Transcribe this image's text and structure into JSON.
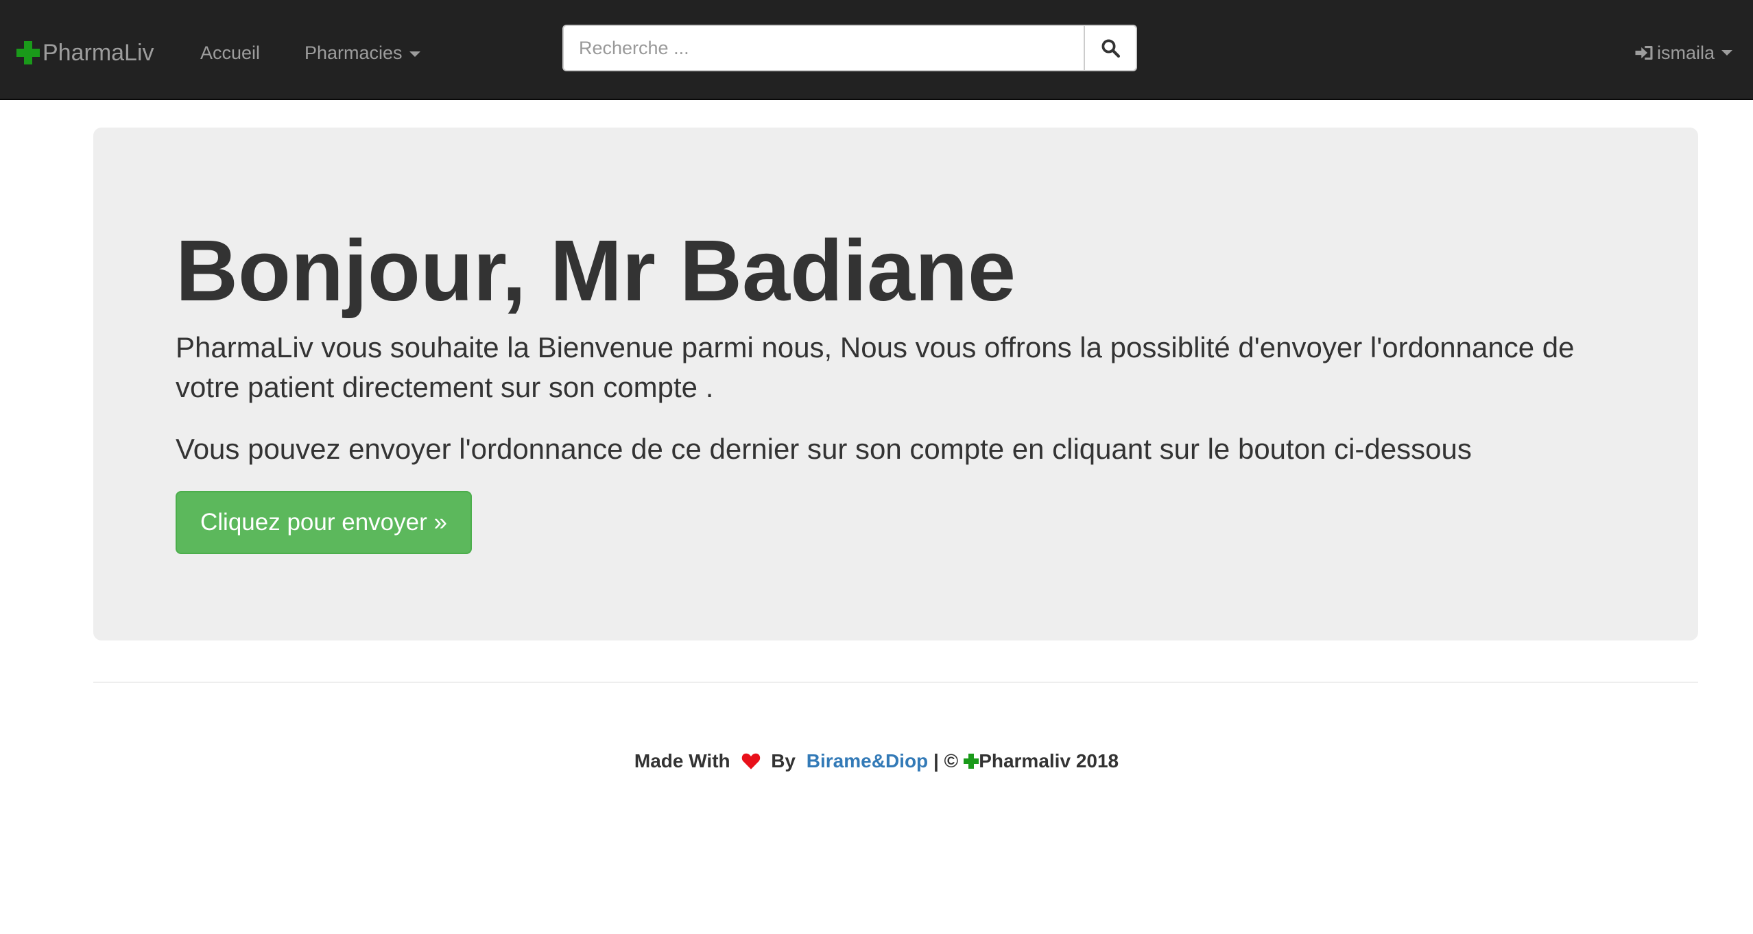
{
  "navbar": {
    "brand": "PharmaLiv",
    "brand_icon": "plus-icon",
    "links": [
      {
        "label": "Accueil"
      },
      {
        "label": "Pharmacies"
      }
    ],
    "search": {
      "placeholder": "Recherche ...",
      "value": "",
      "button_icon": "search-icon"
    },
    "user": {
      "icon": "login-icon",
      "name": "ismaila"
    }
  },
  "jumbotron": {
    "title": "Bonjour, Mr Badiane",
    "lead": "PharmaLiv vous souhaite la Bienvenue parmi nous, Nous vous offrons la possiblité d'envoyer l'ordonnance de votre patient directement sur son compte .",
    "lead2": "Vous pouvez envoyer l'ordonnance de ce dernier sur son compte en cliquant sur le bouton ci-dessous",
    "button_label": "Cliquez pour envoyer »"
  },
  "footer": {
    "made_with": "Made With",
    "heart_icon": "heart-icon",
    "by": "By",
    "authors": "Birame&Diop",
    "copyright": "| ©",
    "brand_year": "Pharmaliv 2018"
  },
  "colors": {
    "navbar_bg": "#222222",
    "brand_green": "#1a9a1a",
    "button_green": "#5cb85c",
    "link_blue": "#337ab7",
    "heart_red": "#e8101a",
    "jumbotron_bg": "#eeeeee"
  }
}
